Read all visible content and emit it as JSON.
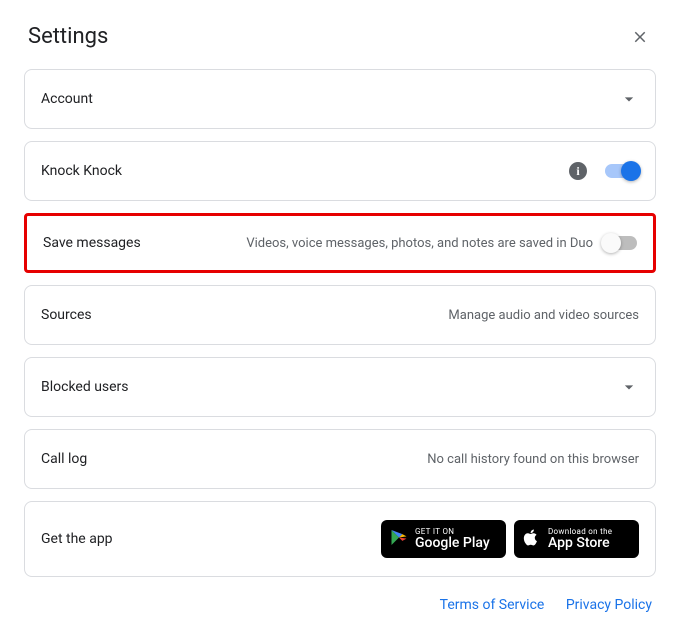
{
  "header": {
    "title": "Settings"
  },
  "rows": {
    "account": {
      "label": "Account"
    },
    "knock": {
      "label": "Knock Knock"
    },
    "save": {
      "label": "Save messages",
      "sub": "Videos, voice messages, photos, and notes are saved in Duo"
    },
    "sources": {
      "label": "Sources",
      "sub": "Manage audio and video sources"
    },
    "blocked": {
      "label": "Blocked users"
    },
    "calllog": {
      "label": "Call log",
      "sub": "No call history found on this browser"
    },
    "getapp": {
      "label": "Get the app"
    }
  },
  "badges": {
    "google": {
      "small": "GET IT ON",
      "big": "Google Play"
    },
    "apple": {
      "small": "Download on the",
      "big": "App Store"
    }
  },
  "footer": {
    "tos": "Terms of Service",
    "privacy": "Privacy Policy"
  }
}
